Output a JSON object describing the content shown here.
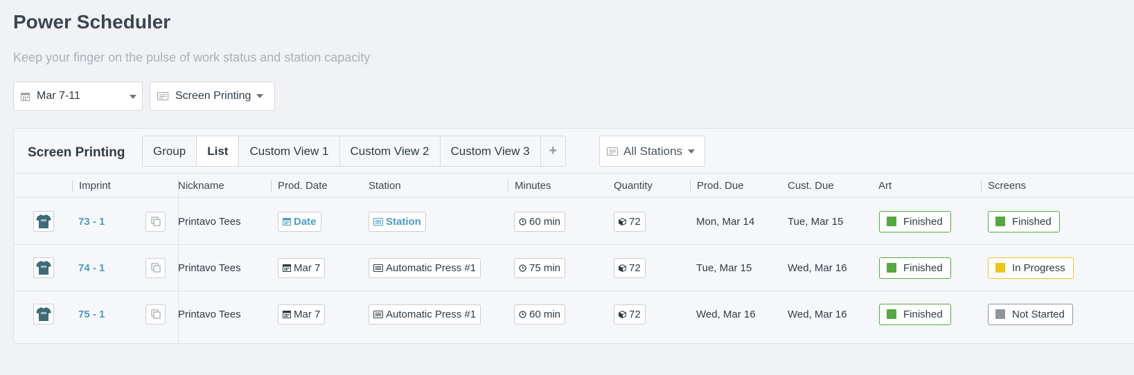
{
  "page": {
    "title": "Power Scheduler",
    "subtitle": "Keep your finger on the pulse of work status and station capacity"
  },
  "filters": {
    "date_range": "Mar 7-11",
    "department": "Screen Printing",
    "icons": {
      "date": "calendar-icon",
      "department": "screen-printing-icon"
    }
  },
  "panel": {
    "title": "Screen Printing",
    "tabs": [
      {
        "label": "Group",
        "active": false
      },
      {
        "label": "List",
        "active": true
      },
      {
        "label": "Custom View 1",
        "active": false
      },
      {
        "label": "Custom View 2",
        "active": false
      },
      {
        "label": "Custom View 3",
        "active": false
      }
    ],
    "add_tab_label": "+",
    "station_filter": "All Stations"
  },
  "columns": {
    "imprint": "Imprint",
    "nickname": "Nickname",
    "prod_date": "Prod. Date",
    "station": "Station",
    "minutes": "Minutes",
    "quantity": "Quantity",
    "prod_due": "Prod. Due",
    "cust_due": "Cust. Due",
    "art": "Art",
    "screens": "Screens"
  },
  "colors": {
    "accent": "#4a9cc2",
    "status_finished": "#54a83f",
    "status_in_progress": "#f2c318",
    "status_not_started": "#8e969c"
  },
  "rows": [
    {
      "imprint": "73 - 1",
      "nickname": "Printavo Tees",
      "prod_date": "Date",
      "prod_date_set": false,
      "station": "Station",
      "station_set": false,
      "minutes": "60 min",
      "quantity": "72",
      "prod_due": "Mon, Mar 14",
      "cust_due": "Tue, Mar 15",
      "art": {
        "label": "Finished",
        "state": "finished"
      },
      "screens": {
        "label": "Finished",
        "state": "finished"
      }
    },
    {
      "imprint": "74 - 1",
      "nickname": "Printavo Tees",
      "prod_date": "Mar 7",
      "prod_date_set": true,
      "station": "Automatic Press #1",
      "station_set": true,
      "minutes": "75 min",
      "quantity": "72",
      "prod_due": "Tue, Mar 15",
      "cust_due": "Wed, Mar 16",
      "art": {
        "label": "Finished",
        "state": "finished"
      },
      "screens": {
        "label": "In Progress",
        "state": "in_progress"
      }
    },
    {
      "imprint": "75 - 1",
      "nickname": "Printavo Tees",
      "prod_date": "Mar 7",
      "prod_date_set": true,
      "station": "Automatic Press #1",
      "station_set": true,
      "minutes": "60 min",
      "quantity": "72",
      "prod_due": "Wed, Mar 16",
      "cust_due": "Wed, Mar 16",
      "art": {
        "label": "Finished",
        "state": "finished"
      },
      "screens": {
        "label": "Not Started",
        "state": "not_started"
      }
    }
  ]
}
